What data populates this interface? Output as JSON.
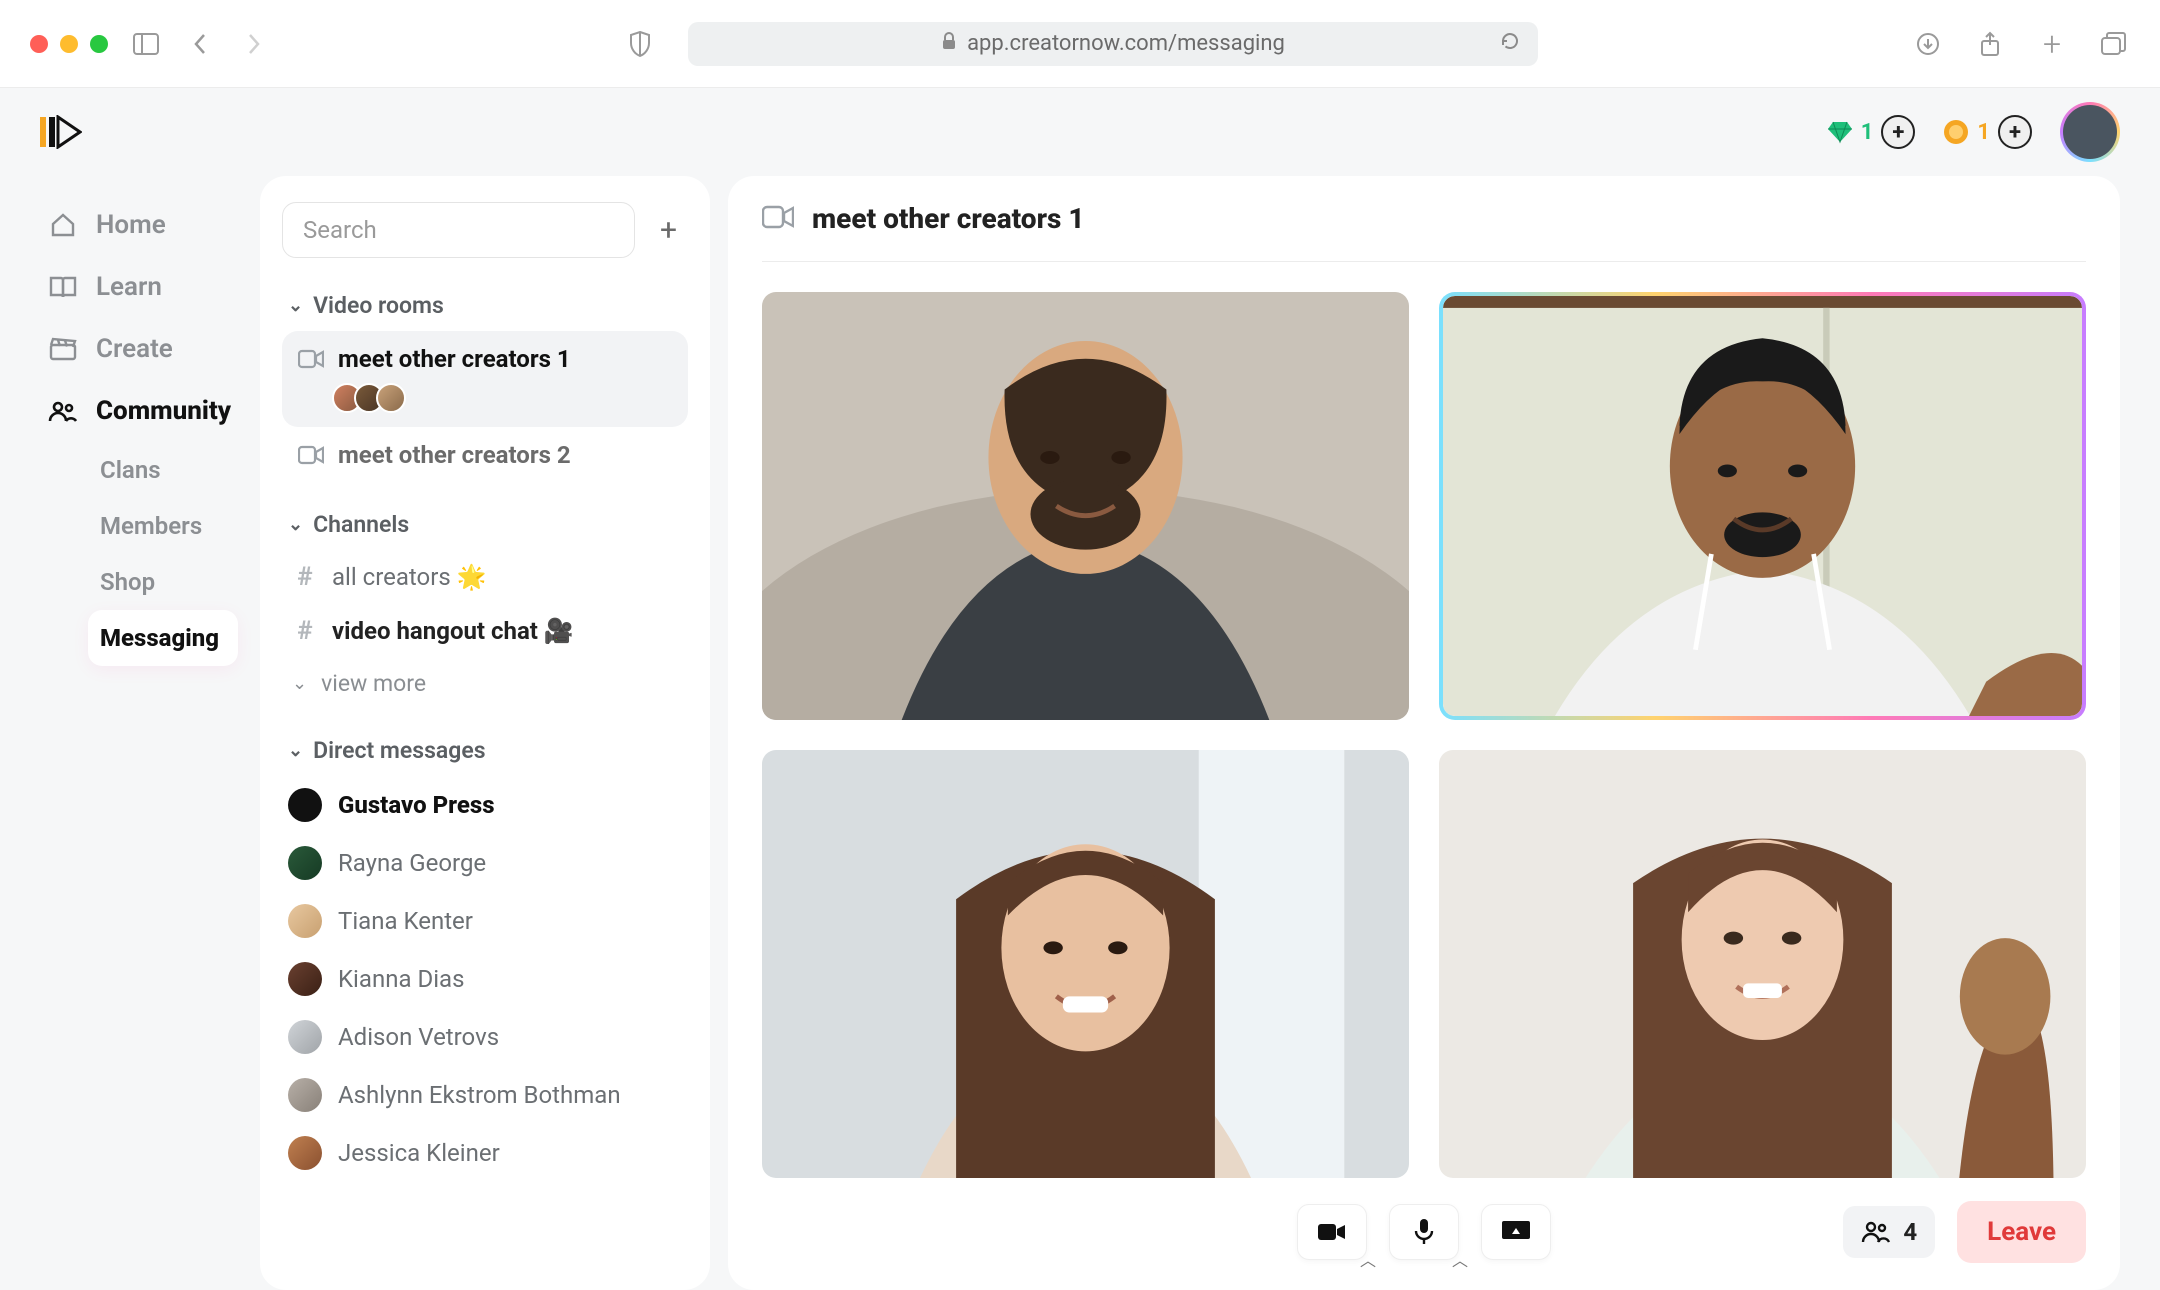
{
  "browser": {
    "url": "app.creatornow.com/messaging"
  },
  "topbar": {
    "gems": "1",
    "coins": "1"
  },
  "nav": {
    "items": [
      {
        "label": "Home"
      },
      {
        "label": "Learn"
      },
      {
        "label": "Create"
      },
      {
        "label": "Community"
      }
    ],
    "sub": [
      {
        "label": "Clans"
      },
      {
        "label": "Members"
      },
      {
        "label": "Shop"
      },
      {
        "label": "Messaging"
      }
    ]
  },
  "mid": {
    "search_placeholder": "Search",
    "sections": {
      "video_rooms": "Video rooms",
      "channels": "Channels",
      "dms": "Direct messages",
      "view_more": "view more"
    },
    "rooms": [
      {
        "label": "meet other creators 1"
      },
      {
        "label": "meet other creators 2"
      }
    ],
    "channels": [
      {
        "label": "all creators 🌟"
      },
      {
        "label": "video hangout chat 🎥"
      }
    ],
    "dms": [
      {
        "name": "Gustavo Press",
        "unread": true
      },
      {
        "name": "Rayna George"
      },
      {
        "name": "Tiana Kenter"
      },
      {
        "name": "Kianna Dias"
      },
      {
        "name": "Adison Vetrovs"
      },
      {
        "name": "Ashlynn Ekstrom Bothman"
      },
      {
        "name": "Jessica Kleiner"
      }
    ]
  },
  "main": {
    "title": "meet other creators 1",
    "participants": "4",
    "leave_label": "Leave"
  }
}
